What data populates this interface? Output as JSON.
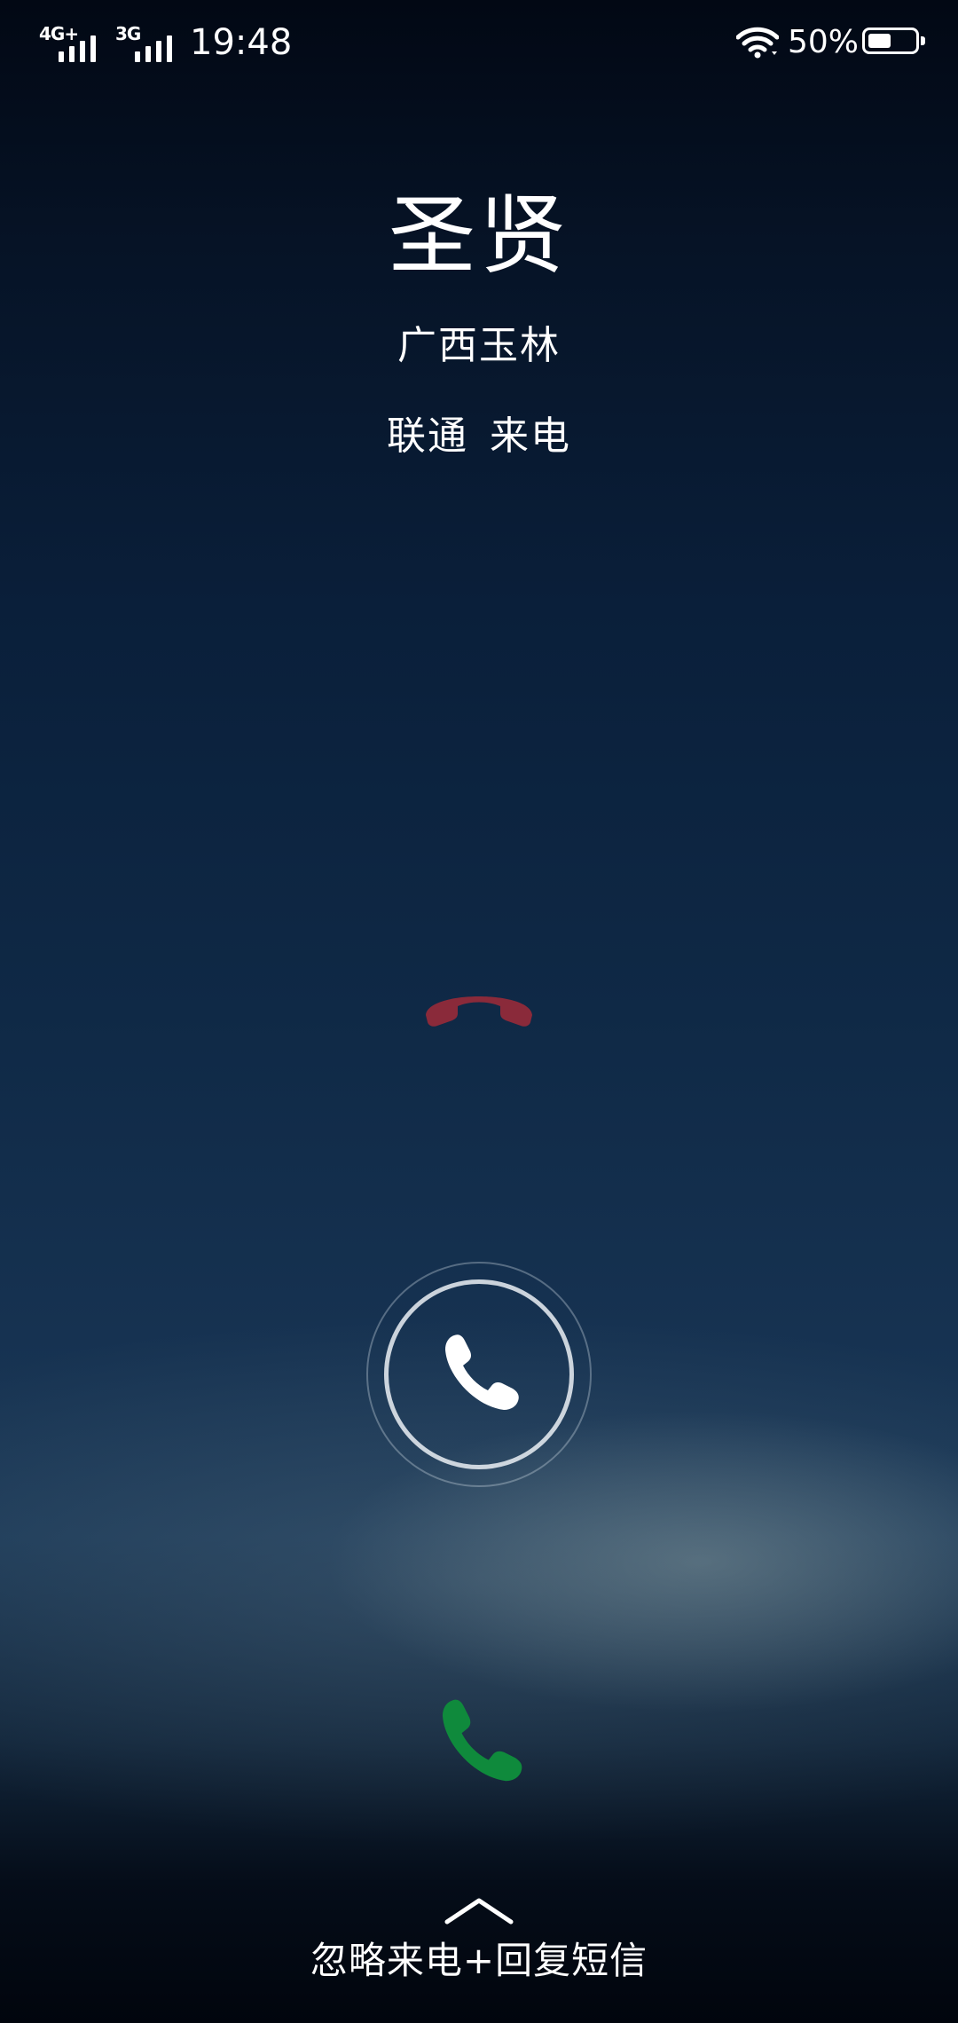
{
  "status_bar": {
    "sim1_tag": "4G+",
    "sim2_tag": "3G",
    "time": "19:48",
    "battery_percent": "50%",
    "battery_level": 0.5
  },
  "caller": {
    "name": "圣贤",
    "location": "广西玉林",
    "carrier": "联通",
    "call_type": "来电"
  },
  "actions": {
    "decline_color": "#8a2a3a",
    "answer_color": "#0f8a3c",
    "ignore_reply_label": "忽略来电+回复短信"
  },
  "icons": {
    "decline": "phone-hangup-icon",
    "slider": "phone-icon",
    "answer": "phone-answer-icon",
    "swipe": "chevron-up-icon"
  }
}
